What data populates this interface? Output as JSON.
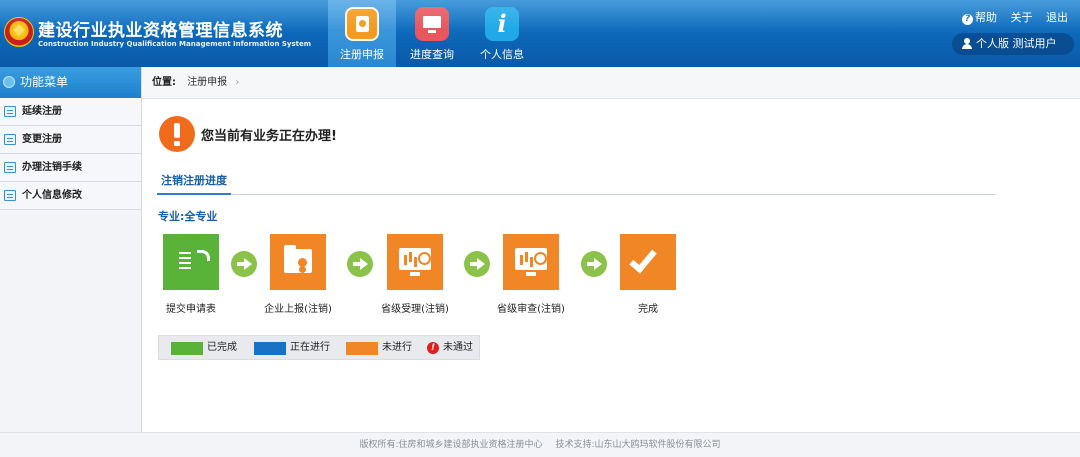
{
  "header": {
    "title": "建设行业执业资格管理信息系统",
    "subtitle": "Construction Industry Qualification Management Information System",
    "nav": [
      {
        "label": "注册申报",
        "icon": "register-icon",
        "active": true
      },
      {
        "label": "进度查询",
        "icon": "monitor-icon",
        "active": false
      },
      {
        "label": "个人信息",
        "icon": "info-icon",
        "glyph": "i",
        "active": false
      }
    ],
    "links": {
      "help": "帮助",
      "about": "关于",
      "logout": "退出",
      "help_glyph": "?"
    },
    "user": {
      "edition": "个人版",
      "name": "测试用户"
    }
  },
  "sidebar": {
    "title": "功能菜单",
    "items": [
      {
        "label": "延续注册"
      },
      {
        "label": "变更注册"
      },
      {
        "label": "办理注销手续"
      },
      {
        "label": "个人信息修改"
      }
    ]
  },
  "breadcrumb": {
    "label": "位置:",
    "page": "注册申报",
    "separator": "›"
  },
  "notice": {
    "text": "您当前有业务正在办理!"
  },
  "tab": {
    "label": "注销注册进度"
  },
  "specialty": {
    "text": "专业:全专业"
  },
  "steps": [
    {
      "label": "提交申请表",
      "status": "已完成",
      "color": "#58b338",
      "icon": "document-icon"
    },
    {
      "label": "企业上报(注销)",
      "status": "未进行",
      "color": "#f08626",
      "icon": "folder-user-icon"
    },
    {
      "label": "省级受理(注销)",
      "status": "未进行",
      "color": "#f08626",
      "icon": "monitor-chart-icon"
    },
    {
      "label": "省级审查(注销)",
      "status": "未进行",
      "color": "#f08626",
      "icon": "monitor-chart-icon"
    },
    {
      "label": "完成",
      "status": "未进行",
      "color": "#f08626",
      "icon": "checkmark-icon"
    }
  ],
  "legend": {
    "completed": {
      "label": "已完成",
      "color": "#58b338"
    },
    "in_progress": {
      "label": "正在进行",
      "color": "#1a72c4"
    },
    "not_started": {
      "label": "未进行",
      "color": "#f08626"
    },
    "failed": {
      "label": "未通过",
      "color": "#e02020",
      "glyph": "!"
    }
  },
  "footer": {
    "copyright": "版权所有:住房和城乡建设部执业资格注册中心",
    "support": "技术支持:山东山大鸥玛软件股份有限公司"
  }
}
